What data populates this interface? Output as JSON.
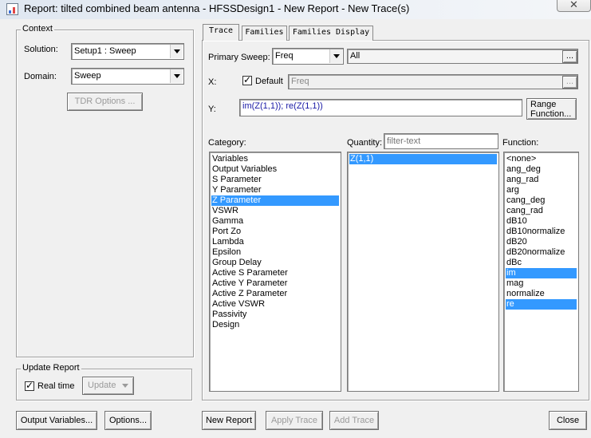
{
  "window": {
    "title": "Report: tilted combined beam antenna - HFSSDesign1 - New Report - New Trace(s)",
    "close_label": "✕"
  },
  "context": {
    "legend": "Context",
    "solution_label": "Solution:",
    "solution_value": "Setup1 : Sweep",
    "domain_label": "Domain:",
    "domain_value": "Sweep",
    "tdr_button": "TDR Options ..."
  },
  "update": {
    "legend": "Update Report",
    "realtime_label": "Real time",
    "realtime_checked": true,
    "update_button": "Update"
  },
  "tabs": [
    {
      "label": "Trace"
    },
    {
      "label": "Families"
    },
    {
      "label": "Families Display"
    }
  ],
  "trace": {
    "primary_sweep_label": "Primary Sweep:",
    "primary_sweep_value": "Freq",
    "sweep_range_value": "All",
    "ellipsis": "...",
    "x_label": "X:",
    "default_label": "Default",
    "default_checked": true,
    "x_value": "Freq",
    "y_label": "Y:",
    "y_value": "im(Z(1,1)); re(Z(1,1))",
    "range_function_button": "Range\nFunction...",
    "range_line1": "Range",
    "range_line2": "Function...",
    "category_label": "Category:",
    "quantity_label": "Quantity:",
    "quantity_filter_placeholder": "filter-text",
    "function_label": "Function:",
    "categories": [
      "Variables",
      "Output Variables",
      "S Parameter",
      "Y Parameter",
      "Z Parameter",
      "VSWR",
      "Gamma",
      "Port Zo",
      "Lambda",
      "Epsilon",
      "Group Delay",
      "Active S Parameter",
      "Active Y Parameter",
      "Active Z Parameter",
      "Active VSWR",
      "Passivity",
      "Design"
    ],
    "selected_category": "Z Parameter",
    "quantities": [
      "Z(1,1)"
    ],
    "selected_quantity": "Z(1,1)",
    "functions": [
      "<none>",
      "ang_deg",
      "ang_rad",
      "arg",
      "cang_deg",
      "cang_rad",
      "dB10",
      "dB10normalize",
      "dB20",
      "dB20normalize",
      "dBc",
      "im",
      "mag",
      "normalize",
      "re"
    ],
    "selected_functions": [
      "im",
      "re"
    ]
  },
  "buttons": {
    "output_variables": "Output Variables...",
    "options": "Options...",
    "new_report": "New Report",
    "apply_trace": "Apply Trace",
    "add_trace": "Add Trace",
    "close": "Close"
  },
  "colors": {
    "selection": "#3399ff",
    "dialog_bg": "#f0f0f0",
    "y_text": "#1a1aa6"
  }
}
